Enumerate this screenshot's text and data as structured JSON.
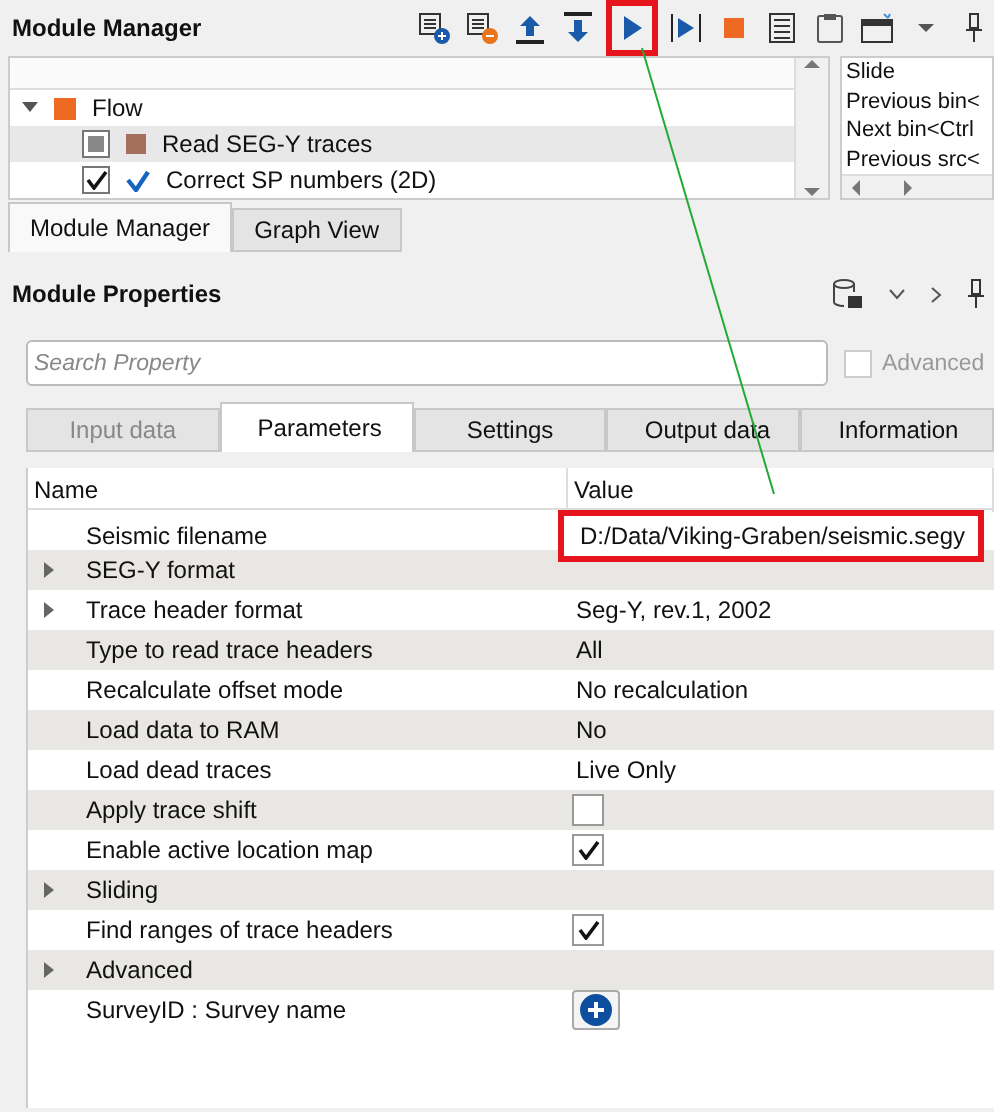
{
  "module_manager": {
    "title": "Module Manager",
    "toolbar": [
      {
        "kind": "add",
        "highlighted": false
      },
      {
        "kind": "remove",
        "highlighted": false
      },
      {
        "kind": "up",
        "highlighted": false
      },
      {
        "kind": "down",
        "highlighted": false
      },
      {
        "kind": "run",
        "highlighted": true
      },
      {
        "kind": "step",
        "highlighted": false
      },
      {
        "kind": "stop",
        "highlighted": false
      },
      {
        "kind": "list",
        "highlighted": false
      },
      {
        "kind": "clipboard",
        "highlighted": false
      },
      {
        "kind": "window",
        "highlighted": false
      },
      {
        "kind": "caret",
        "highlighted": false
      },
      {
        "kind": "pin",
        "highlighted": false
      }
    ],
    "tree": {
      "label": "Flow",
      "color": "#ee6a22",
      "expanded": true,
      "children": [
        {
          "label": "Read SEG-Y traces",
          "kind": "square",
          "color": "#a4705c",
          "checked": false,
          "indeterminate": true,
          "selected": true
        },
        {
          "label": "Correct SP numbers (2D)",
          "kind": "tick",
          "color": "#1565c0",
          "checked": true,
          "selected": false
        }
      ]
    },
    "side_list": [
      "Slide",
      "Previous bin<",
      "Next bin<Ctrl",
      "Previous src<"
    ],
    "tabs": [
      {
        "label": "Module Manager",
        "selected": true
      },
      {
        "label": "Graph View",
        "selected": false
      }
    ]
  },
  "module_properties": {
    "title": "Module Properties",
    "search": {
      "placeholder": "Search Property"
    },
    "advanced": {
      "label": "Advanced",
      "checked": false,
      "disabled": true
    },
    "tabs": [
      {
        "label": "Input data",
        "selected": false,
        "disabled": true
      },
      {
        "label": "Parameters",
        "selected": true,
        "disabled": false
      },
      {
        "label": "Settings",
        "selected": false,
        "disabled": false
      },
      {
        "label": "Output data",
        "selected": false,
        "disabled": false
      },
      {
        "label": "Information",
        "selected": false,
        "disabled": false
      }
    ],
    "columns": [
      "Name",
      "Value"
    ],
    "rows": [
      {
        "name": "Seismic filename",
        "kind": "text",
        "value": "D:/Data/Viking-Graben/seismic.segy",
        "expandable": false,
        "highlighted": true
      },
      {
        "name": "SEG-Y format",
        "kind": "none",
        "expandable": true,
        "highlighted": false
      },
      {
        "name": "Trace header format",
        "kind": "text",
        "value": "Seg-Y, rev.1, 2002",
        "expandable": true,
        "highlighted": false
      },
      {
        "name": "Type to read trace headers",
        "kind": "text",
        "value": "All",
        "expandable": false,
        "highlighted": false
      },
      {
        "name": "Recalculate offset mode",
        "kind": "text",
        "value": "No recalculation",
        "expandable": false,
        "highlighted": false
      },
      {
        "name": "Load data to RAM",
        "kind": "text",
        "value": "No",
        "expandable": false,
        "highlighted": false
      },
      {
        "name": "Load dead traces",
        "kind": "text",
        "value": "Live Only",
        "expandable": false,
        "highlighted": false
      },
      {
        "name": "Apply trace shift",
        "kind": "checkbox",
        "checked": false,
        "expandable": false,
        "highlighted": false
      },
      {
        "name": "Enable active location map",
        "kind": "checkbox",
        "checked": true,
        "expandable": false,
        "highlighted": false
      },
      {
        "name": "Sliding",
        "kind": "none",
        "expandable": true,
        "highlighted": false
      },
      {
        "name": "Find ranges of trace headers",
        "kind": "checkbox",
        "checked": true,
        "expandable": false,
        "highlighted": false
      },
      {
        "name": "Advanced",
        "kind": "none",
        "expandable": true,
        "highlighted": false
      },
      {
        "name": "SurveyID : Survey name",
        "kind": "add",
        "expandable": false,
        "highlighted": false
      }
    ]
  }
}
